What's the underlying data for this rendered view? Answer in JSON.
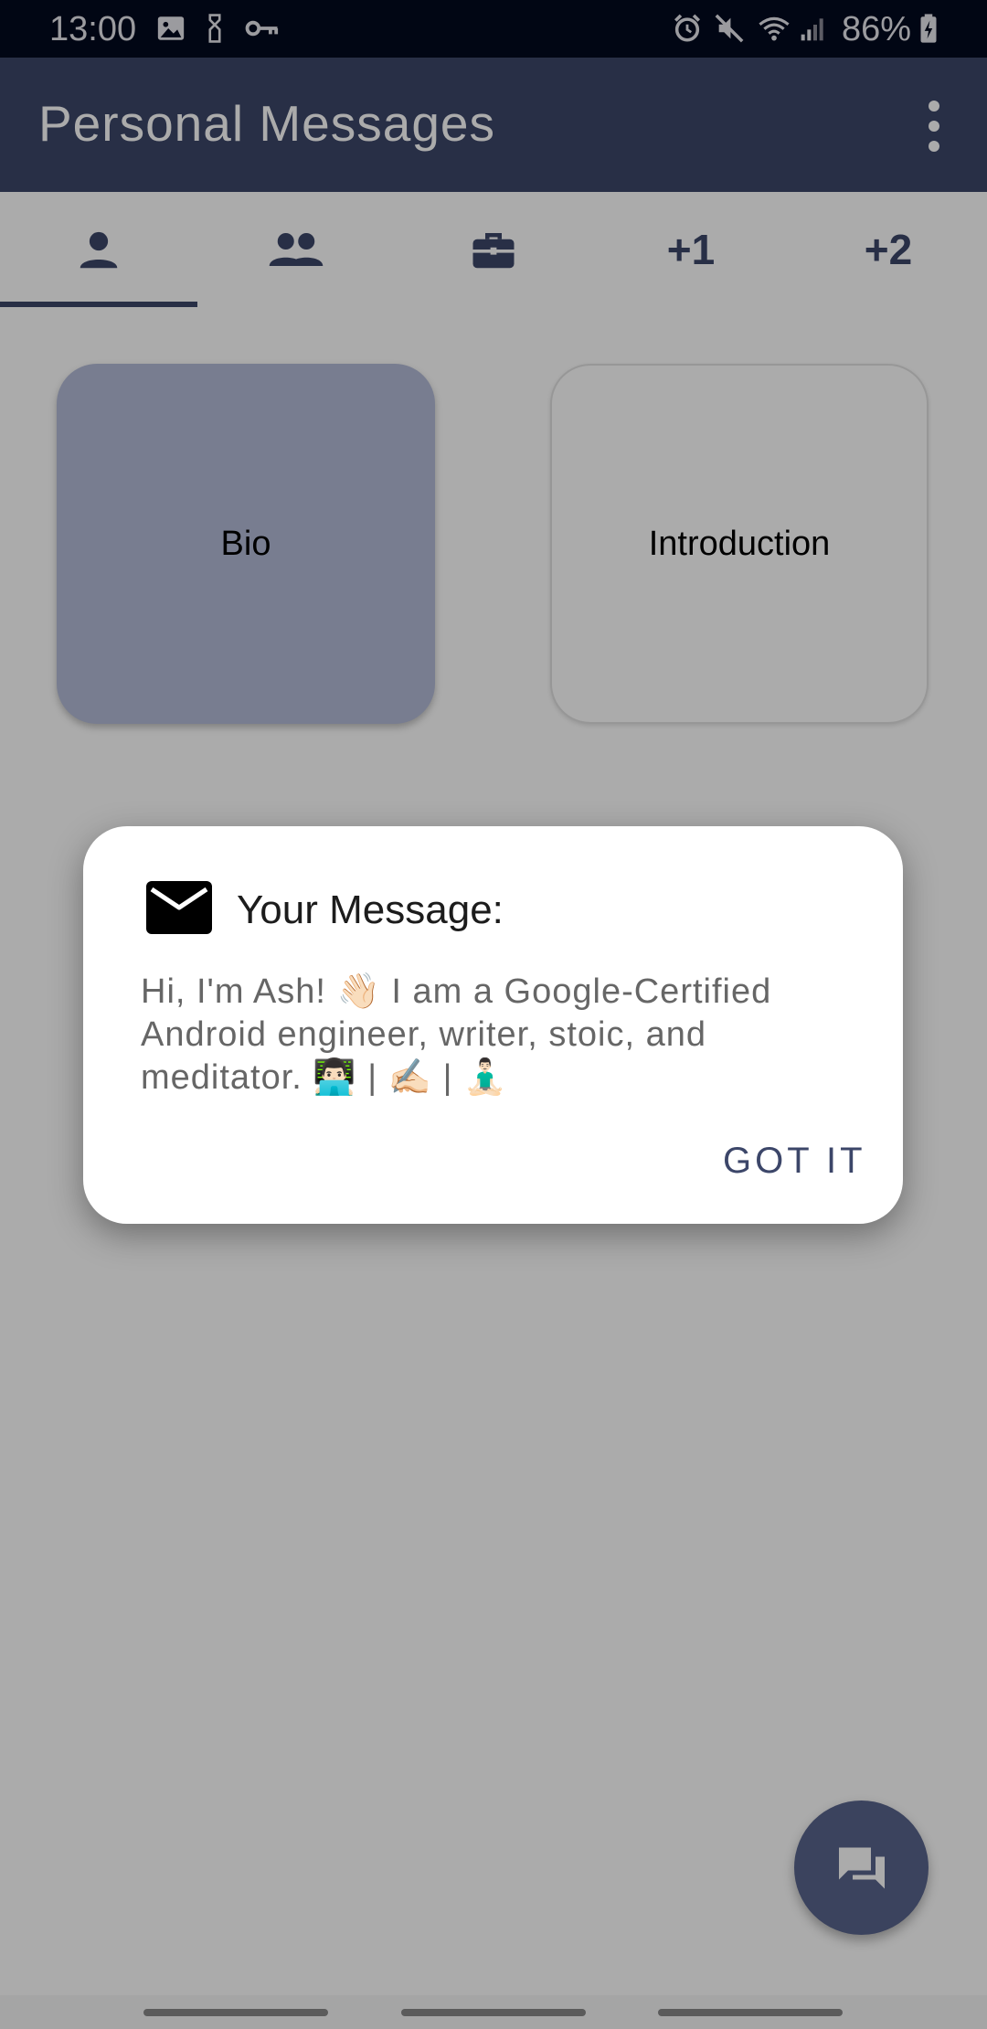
{
  "status_bar": {
    "time": "13:00",
    "battery": "86%",
    "icons_left": [
      "gallery-icon",
      "sim-icon",
      "vpn-key-icon"
    ],
    "icons_right": [
      "alarm-icon",
      "mute-icon",
      "wifi-icon",
      "signal-icon",
      "battery-charging-icon"
    ]
  },
  "app_bar": {
    "title": "Personal Messages",
    "menu_icon": "more-vert-icon"
  },
  "tabs": [
    {
      "type": "icon",
      "icon": "person-icon",
      "selected": true
    },
    {
      "type": "icon",
      "icon": "group-icon",
      "selected": false
    },
    {
      "type": "icon",
      "icon": "briefcase-icon",
      "selected": false
    },
    {
      "type": "text",
      "label": "+1",
      "selected": false
    },
    {
      "type": "text",
      "label": "+2",
      "selected": false
    }
  ],
  "cards": [
    {
      "label": "Bio",
      "selected": true
    },
    {
      "label": "Introduction",
      "selected": false
    }
  ],
  "dialog": {
    "icon": "mail-icon",
    "title": "Your Message:",
    "body": "Hi, I'm Ash! 👋🏻 I am a Google-Certified Android engineer, writer, stoic, and meditator. 👨🏻‍💻 | ✍🏻 | 🧘🏻‍♂️",
    "button": "GOT IT"
  },
  "fab": {
    "icon": "forum-icon"
  },
  "colors": {
    "primary": "#3c4669",
    "selected_card": "#b3bbd7",
    "fab": "#59648d",
    "status_bar": "#02091e"
  }
}
